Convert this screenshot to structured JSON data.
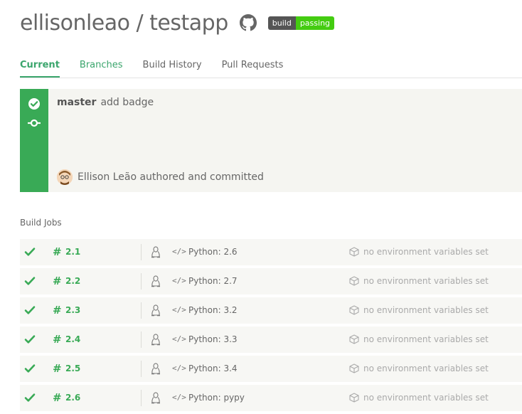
{
  "header": {
    "repo_title": "ellisonleao / testapp",
    "badge_left": "build",
    "badge_right": "passing"
  },
  "tabs": [
    {
      "label": "Current"
    },
    {
      "label": "Branches"
    },
    {
      "label": "Build History"
    },
    {
      "label": "Pull Requests"
    }
  ],
  "build": {
    "branch": "master",
    "message": "add badge",
    "author_text": "Ellison Leão authored and committed",
    "status_color": "#39aa56"
  },
  "jobs_label": "Build Jobs",
  "jobs": [
    {
      "number": "2.1",
      "language": "Python: 2.6",
      "env": "no environment variables set"
    },
    {
      "number": "2.2",
      "language": "Python: 2.7",
      "env": "no environment variables set"
    },
    {
      "number": "2.3",
      "language": "Python: 3.2",
      "env": "no environment variables set"
    },
    {
      "number": "2.4",
      "language": "Python: 3.3",
      "env": "no environment variables set"
    },
    {
      "number": "2.5",
      "language": "Python: 3.4",
      "env": "no environment variables set"
    },
    {
      "number": "2.6",
      "language": "Python: pypy",
      "env": "no environment variables set"
    }
  ],
  "icons": {
    "github": "github-icon",
    "passed": "check-circle-icon",
    "commit": "commit-icon",
    "job_status": "check-icon",
    "os": "linux-icon",
    "language": "code-icon",
    "env": "box-icon"
  }
}
